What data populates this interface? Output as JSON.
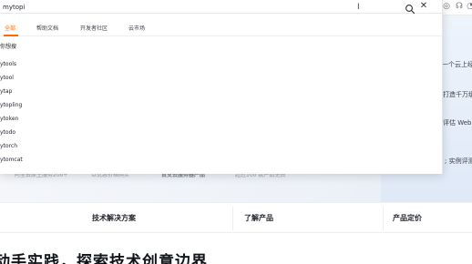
{
  "search": {
    "query": "mytopi",
    "cursor_glyph": "I"
  },
  "tabs": [
    {
      "label": "全部",
      "active": true
    },
    {
      "label": "帮助文档",
      "active": false
    },
    {
      "label": "开发者社区",
      "active": false
    },
    {
      "label": "云市场",
      "active": false
    }
  ],
  "suggestions": [
    "你想搜",
    "ytools",
    "ytool",
    "ytap",
    "ytopling",
    "ytoken",
    "ytodo",
    "ytorch",
    "ytomcat"
  ],
  "background": {
    "side_snippets": [
      "一个云上经典",
      "打造千万级 F",
      "评估 Web 服",
      "; 实例评测征"
    ],
    "faded_row": [
      "阿里云原生服务200+",
      "以优惠价格购买",
      "首支云服务器产品",
      "超过100 款产品免费"
    ],
    "nav": [
      "技术解决方案",
      "了解产品",
      "产品定价"
    ],
    "heading": "动手实践，探索技术创意边界"
  },
  "colors": {
    "accent": "#ff6a00",
    "text": "#1f2329"
  }
}
